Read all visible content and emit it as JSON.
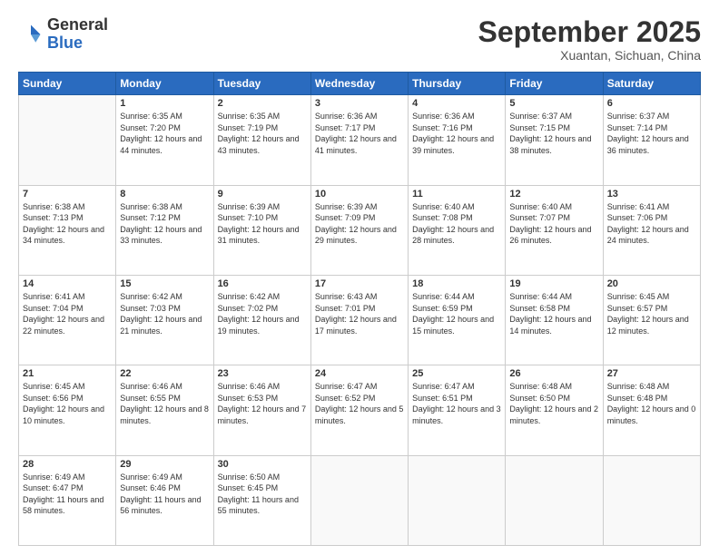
{
  "logo": {
    "general": "General",
    "blue": "Blue"
  },
  "header": {
    "month": "September 2025",
    "location": "Xuantan, Sichuan, China"
  },
  "days_of_week": [
    "Sunday",
    "Monday",
    "Tuesday",
    "Wednesday",
    "Thursday",
    "Friday",
    "Saturday"
  ],
  "weeks": [
    [
      {
        "day": "",
        "empty": true
      },
      {
        "day": "1",
        "sunrise": "6:35 AM",
        "sunset": "7:20 PM",
        "daylight": "12 hours and 44 minutes."
      },
      {
        "day": "2",
        "sunrise": "6:35 AM",
        "sunset": "7:19 PM",
        "daylight": "12 hours and 43 minutes."
      },
      {
        "day": "3",
        "sunrise": "6:36 AM",
        "sunset": "7:17 PM",
        "daylight": "12 hours and 41 minutes."
      },
      {
        "day": "4",
        "sunrise": "6:36 AM",
        "sunset": "7:16 PM",
        "daylight": "12 hours and 39 minutes."
      },
      {
        "day": "5",
        "sunrise": "6:37 AM",
        "sunset": "7:15 PM",
        "daylight": "12 hours and 38 minutes."
      },
      {
        "day": "6",
        "sunrise": "6:37 AM",
        "sunset": "7:14 PM",
        "daylight": "12 hours and 36 minutes."
      }
    ],
    [
      {
        "day": "7",
        "sunrise": "6:38 AM",
        "sunset": "7:13 PM",
        "daylight": "12 hours and 34 minutes."
      },
      {
        "day": "8",
        "sunrise": "6:38 AM",
        "sunset": "7:12 PM",
        "daylight": "12 hours and 33 minutes."
      },
      {
        "day": "9",
        "sunrise": "6:39 AM",
        "sunset": "7:10 PM",
        "daylight": "12 hours and 31 minutes."
      },
      {
        "day": "10",
        "sunrise": "6:39 AM",
        "sunset": "7:09 PM",
        "daylight": "12 hours and 29 minutes."
      },
      {
        "day": "11",
        "sunrise": "6:40 AM",
        "sunset": "7:08 PM",
        "daylight": "12 hours and 28 minutes."
      },
      {
        "day": "12",
        "sunrise": "6:40 AM",
        "sunset": "7:07 PM",
        "daylight": "12 hours and 26 minutes."
      },
      {
        "day": "13",
        "sunrise": "6:41 AM",
        "sunset": "7:06 PM",
        "daylight": "12 hours and 24 minutes."
      }
    ],
    [
      {
        "day": "14",
        "sunrise": "6:41 AM",
        "sunset": "7:04 PM",
        "daylight": "12 hours and 22 minutes."
      },
      {
        "day": "15",
        "sunrise": "6:42 AM",
        "sunset": "7:03 PM",
        "daylight": "12 hours and 21 minutes."
      },
      {
        "day": "16",
        "sunrise": "6:42 AM",
        "sunset": "7:02 PM",
        "daylight": "12 hours and 19 minutes."
      },
      {
        "day": "17",
        "sunrise": "6:43 AM",
        "sunset": "7:01 PM",
        "daylight": "12 hours and 17 minutes."
      },
      {
        "day": "18",
        "sunrise": "6:44 AM",
        "sunset": "6:59 PM",
        "daylight": "12 hours and 15 minutes."
      },
      {
        "day": "19",
        "sunrise": "6:44 AM",
        "sunset": "6:58 PM",
        "daylight": "12 hours and 14 minutes."
      },
      {
        "day": "20",
        "sunrise": "6:45 AM",
        "sunset": "6:57 PM",
        "daylight": "12 hours and 12 minutes."
      }
    ],
    [
      {
        "day": "21",
        "sunrise": "6:45 AM",
        "sunset": "6:56 PM",
        "daylight": "12 hours and 10 minutes."
      },
      {
        "day": "22",
        "sunrise": "6:46 AM",
        "sunset": "6:55 PM",
        "daylight": "12 hours and 8 minutes."
      },
      {
        "day": "23",
        "sunrise": "6:46 AM",
        "sunset": "6:53 PM",
        "daylight": "12 hours and 7 minutes."
      },
      {
        "day": "24",
        "sunrise": "6:47 AM",
        "sunset": "6:52 PM",
        "daylight": "12 hours and 5 minutes."
      },
      {
        "day": "25",
        "sunrise": "6:47 AM",
        "sunset": "6:51 PM",
        "daylight": "12 hours and 3 minutes."
      },
      {
        "day": "26",
        "sunrise": "6:48 AM",
        "sunset": "6:50 PM",
        "daylight": "12 hours and 2 minutes."
      },
      {
        "day": "27",
        "sunrise": "6:48 AM",
        "sunset": "6:48 PM",
        "daylight": "12 hours and 0 minutes."
      }
    ],
    [
      {
        "day": "28",
        "sunrise": "6:49 AM",
        "sunset": "6:47 PM",
        "daylight": "11 hours and 58 minutes."
      },
      {
        "day": "29",
        "sunrise": "6:49 AM",
        "sunset": "6:46 PM",
        "daylight": "11 hours and 56 minutes."
      },
      {
        "day": "30",
        "sunrise": "6:50 AM",
        "sunset": "6:45 PM",
        "daylight": "11 hours and 55 minutes."
      },
      {
        "day": "",
        "empty": true
      },
      {
        "day": "",
        "empty": true
      },
      {
        "day": "",
        "empty": true
      },
      {
        "day": "",
        "empty": true
      }
    ]
  ]
}
